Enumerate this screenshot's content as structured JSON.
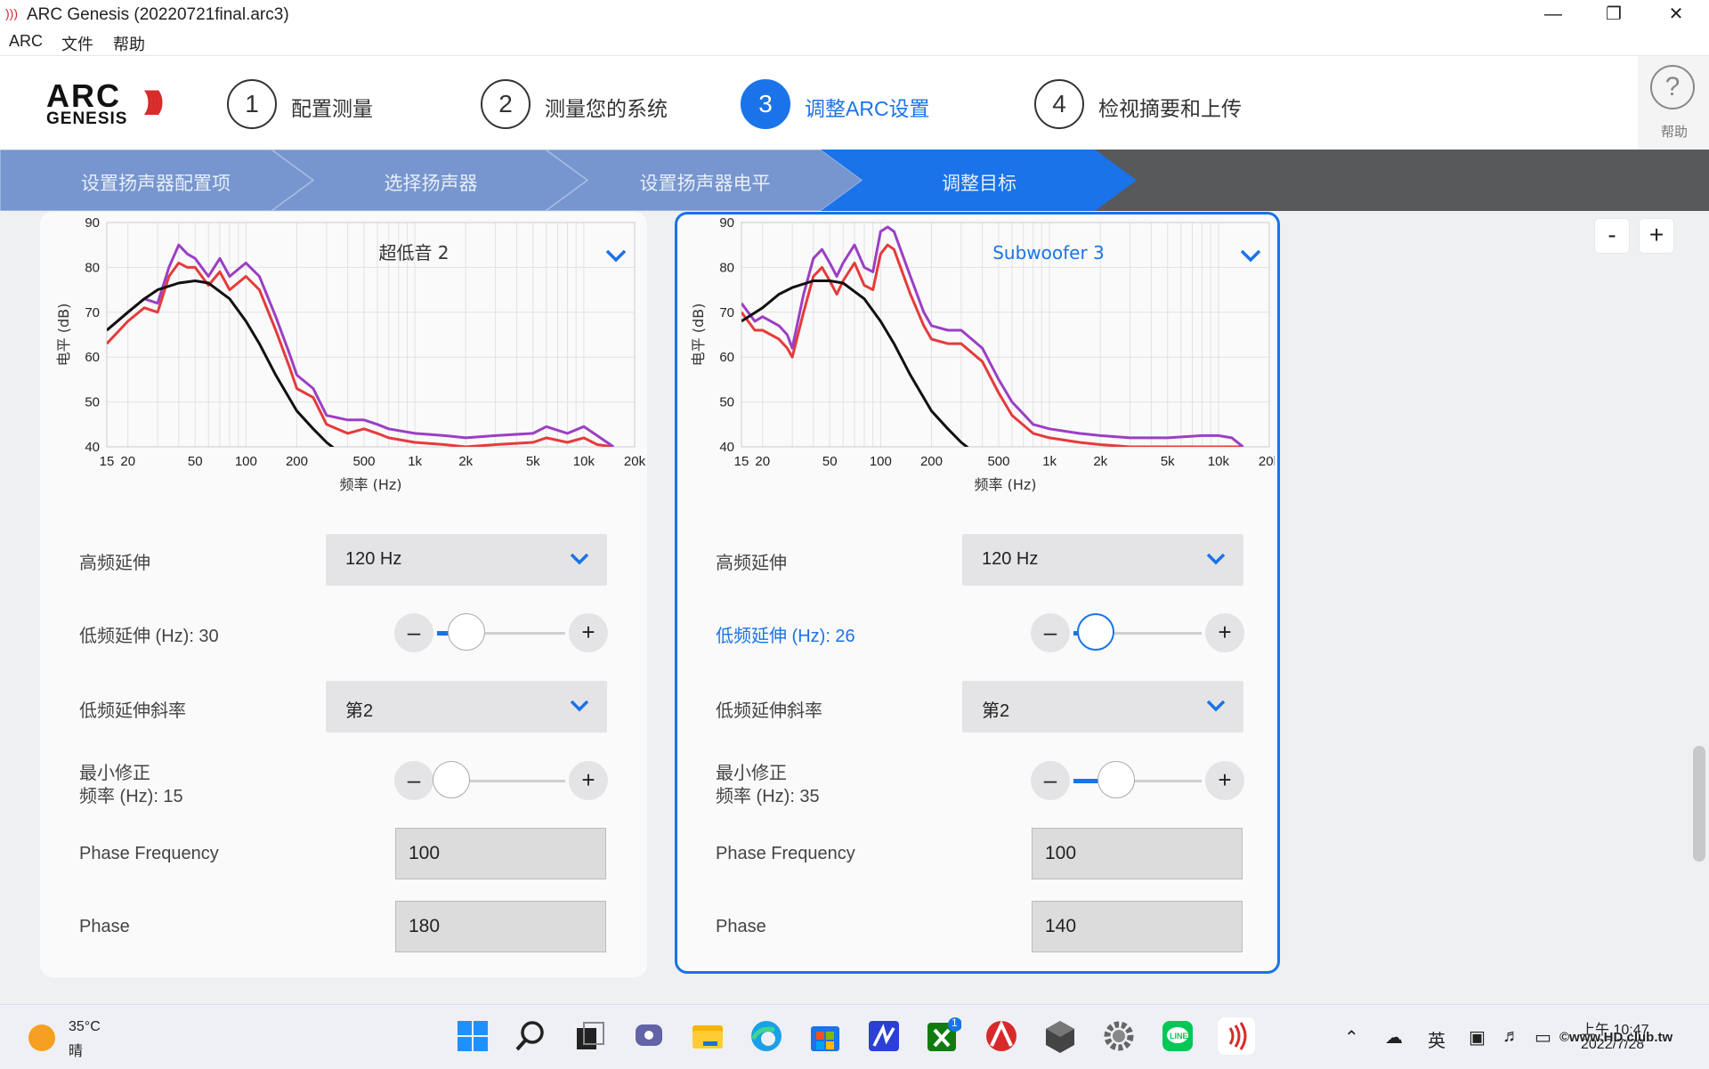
{
  "window": {
    "title": "ARC Genesis (20220721final.arc3)"
  },
  "menu": [
    "ARC",
    "文件",
    "帮助"
  ],
  "header": {
    "logo_top": "ARC",
    "logo_bottom": "GENESIS",
    "steps": [
      {
        "num": "1",
        "label": "配置测量"
      },
      {
        "num": "2",
        "label": "测量您的系统"
      },
      {
        "num": "3",
        "label": "调整ARC设置"
      },
      {
        "num": "4",
        "label": "检视摘要和上传"
      }
    ],
    "help_label": "帮助"
  },
  "crumbs": [
    "设置扬声器配置项",
    "选择扬声器",
    "设置扬声器电平",
    "调整目标"
  ],
  "colors": {
    "accent": "#1a73e8",
    "crumb_inactive": "#7796cf",
    "crumb_active": "#1a73e8",
    "measured": "#e53b3b",
    "corrected": "#9b3fc4",
    "target": "#111111"
  },
  "zoom": {
    "minus": "-",
    "plus": "+"
  },
  "cards": [
    {
      "name": "超低音 2",
      "row_labels": {
        "hf": "高频延伸",
        "lf": "低频延伸 (Hz): 30",
        "slope": "低频延伸斜率",
        "minfix1": "最小修正",
        "minfix2": "频率 (Hz): 15",
        "phasefreq": "Phase Frequency",
        "phase": "Phase"
      },
      "hf_value": "120 Hz",
      "slope_value": "第2",
      "lf_slider": 0.12,
      "min_slider": 0.0,
      "phase_frequency": "100",
      "phase": "180"
    },
    {
      "name": "Subwoofer 3",
      "row_labels": {
        "hf": "高频延伸",
        "lf": "低频延伸 (Hz): 26",
        "slope": "低频延伸斜率",
        "minfix1": "最小修正",
        "minfix2": "频率 (Hz): 35",
        "phasefreq": "Phase Frequency",
        "phase": "Phase"
      },
      "hf_value": "120 Hz",
      "slope_value": "第2",
      "lf_slider": 0.06,
      "min_slider": 0.22,
      "phase_frequency": "100",
      "phase": "140"
    }
  ],
  "chart_data": [
    {
      "type": "line",
      "title": "超低音 2",
      "xlabel": "频率 (Hz)",
      "ylabel": "电平 (dB)",
      "xscale": "log",
      "xlim": [
        15,
        20000
      ],
      "ylim": [
        40,
        90
      ],
      "xticks": [
        "15",
        "20",
        "50",
        "100",
        "200",
        "500",
        "1k",
        "2k",
        "5k",
        "10k",
        "20k"
      ],
      "yticks": [
        "90",
        "80",
        "70",
        "60",
        "50",
        "40"
      ],
      "grid": true,
      "series": [
        {
          "color": "#e53b3b",
          "x": [
            15,
            20,
            25,
            30,
            35,
            40,
            45,
            50,
            60,
            70,
            80,
            100,
            120,
            150,
            180,
            200,
            250,
            300,
            400,
            500,
            600,
            700,
            1000,
            1500,
            2000,
            3000,
            5000,
            6000,
            8000,
            10000,
            12000,
            15000
          ],
          "y": [
            63,
            68,
            71,
            70,
            78,
            81,
            80,
            80,
            76,
            79,
            75,
            78,
            75,
            66,
            58,
            53,
            51,
            45,
            43,
            44,
            43,
            42,
            41,
            40.5,
            40,
            40.5,
            41,
            42,
            41,
            42,
            40.5,
            40
          ]
        },
        {
          "color": "#9b3fc4",
          "x": [
            15,
            20,
            25,
            30,
            35,
            40,
            45,
            50,
            60,
            70,
            80,
            100,
            120,
            150,
            180,
            200,
            250,
            300,
            400,
            500,
            600,
            700,
            1000,
            1500,
            2000,
            3000,
            5000,
            6000,
            8000,
            10000,
            12000,
            15000
          ],
          "y": [
            66,
            70,
            73,
            72,
            80,
            85,
            83,
            82,
            78,
            82,
            78,
            81,
            78,
            69,
            61,
            56,
            53,
            47,
            46,
            46,
            45,
            44,
            43,
            42.5,
            42,
            42.5,
            43,
            44.5,
            43,
            44.5,
            42.5,
            40
          ]
        },
        {
          "color": "#111111",
          "x": [
            15,
            20,
            25,
            30,
            40,
            50,
            60,
            80,
            100,
            120,
            150,
            200,
            250,
            300,
            350
          ],
          "y": [
            66,
            70,
            73,
            75,
            76.5,
            77,
            76.5,
            73,
            68,
            63,
            56,
            48,
            44,
            41,
            39
          ]
        }
      ]
    },
    {
      "type": "line",
      "title": "Subwoofer 3",
      "xlabel": "频率 (Hz)",
      "ylabel": "电平 (dB)",
      "xscale": "log",
      "xlim": [
        15,
        20000
      ],
      "ylim": [
        40,
        90
      ],
      "xticks": [
        "15",
        "20",
        "50",
        "100",
        "200",
        "500",
        "1k",
        "2k",
        "5k",
        "10k",
        "20k"
      ],
      "yticks": [
        "90",
        "80",
        "70",
        "60",
        "50",
        "40"
      ],
      "grid": true,
      "series": [
        {
          "color": "#e53b3b",
          "x": [
            15,
            18,
            20,
            25,
            28,
            30,
            35,
            40,
            45,
            50,
            55,
            60,
            70,
            80,
            90,
            100,
            110,
            120,
            150,
            180,
            200,
            250,
            300,
            400,
            500,
            600,
            800,
            1000,
            1500,
            2000,
            3000,
            5000,
            8000,
            10000,
            12000,
            14000
          ],
          "y": [
            70,
            66,
            66,
            64,
            62,
            60,
            70,
            78,
            80,
            77,
            74,
            77,
            81,
            76,
            75,
            83,
            85,
            84,
            74,
            67,
            64,
            63,
            63,
            59,
            52,
            47,
            43,
            42,
            41,
            40.5,
            40,
            40,
            40,
            40,
            40,
            40
          ]
        },
        {
          "color": "#9b3fc4",
          "x": [
            15,
            18,
            20,
            25,
            28,
            30,
            35,
            40,
            45,
            50,
            55,
            60,
            70,
            80,
            90,
            100,
            110,
            120,
            150,
            180,
            200,
            250,
            300,
            400,
            500,
            600,
            800,
            1000,
            1500,
            2000,
            3000,
            5000,
            8000,
            10000,
            12000,
            14000
          ],
          "y": [
            72,
            68,
            69,
            67,
            65,
            62,
            74,
            82,
            84,
            81,
            78,
            81,
            85,
            80,
            79,
            88,
            89,
            88,
            78,
            70,
            67,
            66,
            66,
            62,
            55,
            50,
            45,
            44,
            43,
            42.5,
            42,
            42,
            42.5,
            42.5,
            42,
            40
          ]
        },
        {
          "color": "#111111",
          "x": [
            15,
            20,
            25,
            30,
            40,
            50,
            60,
            80,
            100,
            120,
            150,
            200,
            250,
            300,
            350
          ],
          "y": [
            68,
            71,
            74,
            75.5,
            77,
            77,
            76.5,
            73,
            68,
            63,
            56,
            48,
            44,
            41,
            39
          ]
        }
      ]
    }
  ],
  "taskbar": {
    "temp": "35°C",
    "weather": "晴",
    "tray_lang": "英",
    "time": "上午 10:47",
    "date": "2022/7/28",
    "watermark": "©www.HD.club.tw",
    "badge": "1"
  }
}
